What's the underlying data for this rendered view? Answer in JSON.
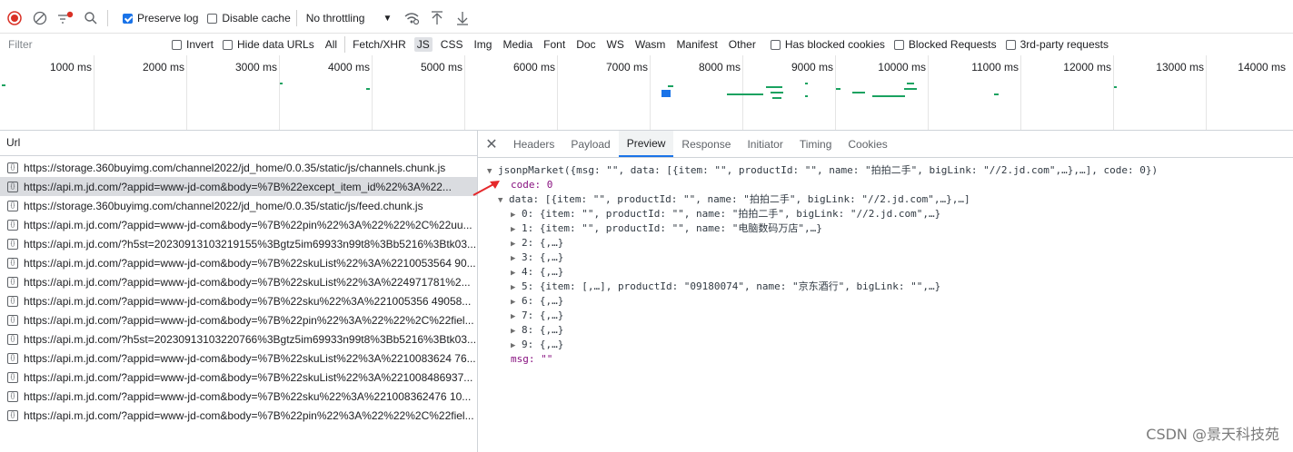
{
  "toolbar": {
    "preserve_log": "Preserve log",
    "disable_cache": "Disable cache",
    "throttling": "No throttling"
  },
  "filterbar": {
    "placeholder": "Filter",
    "invert": "Invert",
    "hide_data_urls": "Hide data URLs",
    "types": [
      "All",
      "Fetch/XHR",
      "JS",
      "CSS",
      "Img",
      "Media",
      "Font",
      "Doc",
      "WS",
      "Wasm",
      "Manifest",
      "Other"
    ],
    "has_blocked_cookies": "Has blocked cookies",
    "blocked_requests": "Blocked Requests",
    "third_party": "3rd-party requests"
  },
  "timeline": {
    "ticks": [
      "1000 ms",
      "2000 ms",
      "3000 ms",
      "4000 ms",
      "5000 ms",
      "6000 ms",
      "7000 ms",
      "8000 ms",
      "9000 ms",
      "10000 ms",
      "11000 ms",
      "12000 ms",
      "13000 ms",
      "14000 ms"
    ]
  },
  "requests": {
    "column": "Url",
    "items": [
      "https://storage.360buyimg.com/channel2022/jd_home/0.0.35/static/js/channels.chunk.js",
      "https://api.m.jd.com/?appid=www-jd-com&body=%7B%22except_item_id%22%3A%22...",
      "https://storage.360buyimg.com/channel2022/jd_home/0.0.35/static/js/feed.chunk.js",
      "https://api.m.jd.com/?appid=www-jd-com&body=%7B%22pin%22%3A%22%22%2C%22uu...",
      "https://api.m.jd.com/?h5st=20230913103219155%3Bgtz5im69933n99t8%3Bb5216%3Btk03...",
      "https://api.m.jd.com/?appid=www-jd-com&body=%7B%22skuList%22%3A%2210053564 90...",
      "https://api.m.jd.com/?appid=www-jd-com&body=%7B%22skuList%22%3A%224971781%2...",
      "https://api.m.jd.com/?appid=www-jd-com&body=%7B%22sku%22%3A%221005356 49058...",
      "https://api.m.jd.com/?appid=www-jd-com&body=%7B%22pin%22%3A%22%22%2C%22fiel...",
      "https://api.m.jd.com/?h5st=20230913103220766%3Bgtz5im69933n99t8%3Bb5216%3Btk03...",
      "https://api.m.jd.com/?appid=www-jd-com&body=%7B%22skuList%22%3A%2210083624 76...",
      "https://api.m.jd.com/?appid=www-jd-com&body=%7B%22skuList%22%3A%221008486937...",
      "https://api.m.jd.com/?appid=www-jd-com&body=%7B%22sku%22%3A%221008362476 10...",
      "https://api.m.jd.com/?appid=www-jd-com&body=%7B%22pin%22%3A%22%22%2C%22fiel..."
    ]
  },
  "detail": {
    "tabs": [
      "Headers",
      "Payload",
      "Preview",
      "Response",
      "Initiator",
      "Timing",
      "Cookies"
    ],
    "active_tab": "Preview",
    "lines": [
      "jsonpMarket({msg: \"\", data: [{item: \"\", productId: \"\", name: \"拍拍二手\", bigLink: \"//2.jd.com\",…},…], code: 0})",
      "code: 0",
      "data: [{item: \"\", productId: \"\", name: \"拍拍二手\", bigLink: \"//2.jd.com\",…},…]",
      "0: {item: \"\", productId: \"\", name: \"拍拍二手\", bigLink: \"//2.jd.com\",…}",
      "1: {item: \"\", productId: \"\", name: \"电脑数码万店\",…}",
      "2: {,…}",
      "3: {,…}",
      "4: {,…}",
      "5: {item: [,…], productId: \"09180074\", name: \"京东酒行\", bigLink: \"\",…}",
      "6: {,…}",
      "7: {,…}",
      "8: {,…}",
      "9: {,…}",
      "msg: \"\""
    ]
  },
  "watermark": "CSDN @景天科技苑",
  "colors": {
    "accent": "#1a73e8",
    "record": "#d93025",
    "waterfall": "#1aa260"
  }
}
